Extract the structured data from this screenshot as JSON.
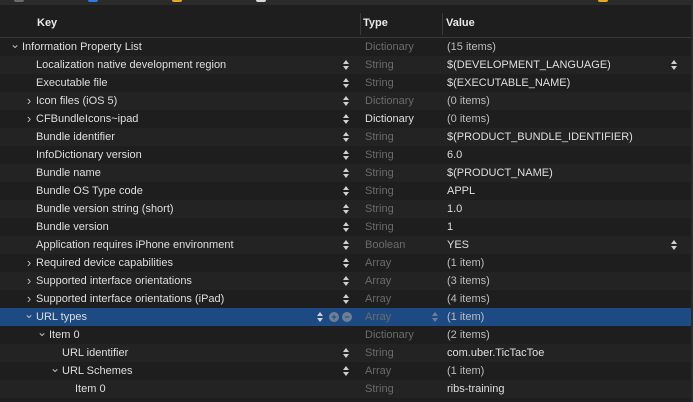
{
  "header": {
    "key": "Key",
    "type": "Type",
    "value": "Value"
  },
  "colors": {
    "selection": "#1d4a82",
    "background": "#1e1e1e",
    "dimText": "#6b6b6b"
  },
  "rows": [
    {
      "key": "Information Property List",
      "type": "Dictionary",
      "value": "(15 items)",
      "indent": 0,
      "disclosure": "expanded",
      "typeDim": true,
      "valueDim": true,
      "stepper": false,
      "valueStepper": false
    },
    {
      "key": "Localization native development region",
      "type": "String",
      "value": "$(DEVELOPMENT_LANGUAGE)",
      "indent": 1,
      "disclosure": "none",
      "typeDim": true,
      "valueDim": false,
      "stepper": true,
      "valueStepper": true
    },
    {
      "key": "Executable file",
      "type": "String",
      "value": "$(EXECUTABLE_NAME)",
      "indent": 1,
      "disclosure": "none",
      "typeDim": true,
      "valueDim": false,
      "stepper": true,
      "valueStepper": false
    },
    {
      "key": "Icon files (iOS 5)",
      "type": "Dictionary",
      "value": "(0 items)",
      "indent": 1,
      "disclosure": "collapsed",
      "typeDim": true,
      "valueDim": true,
      "stepper": true,
      "valueStepper": false
    },
    {
      "key": "CFBundleIcons~ipad",
      "type": "Dictionary",
      "value": "(0 items)",
      "indent": 1,
      "disclosure": "collapsed",
      "typeDim": false,
      "valueDim": true,
      "stepper": true,
      "valueStepper": false
    },
    {
      "key": "Bundle identifier",
      "type": "String",
      "value": "$(PRODUCT_BUNDLE_IDENTIFIER)",
      "indent": 1,
      "disclosure": "none",
      "typeDim": true,
      "valueDim": false,
      "stepper": true,
      "valueStepper": false
    },
    {
      "key": "InfoDictionary version",
      "type": "String",
      "value": "6.0",
      "indent": 1,
      "disclosure": "none",
      "typeDim": true,
      "valueDim": false,
      "stepper": true,
      "valueStepper": false
    },
    {
      "key": "Bundle name",
      "type": "String",
      "value": "$(PRODUCT_NAME)",
      "indent": 1,
      "disclosure": "none",
      "typeDim": true,
      "valueDim": false,
      "stepper": true,
      "valueStepper": false
    },
    {
      "key": "Bundle OS Type code",
      "type": "String",
      "value": "APPL",
      "indent": 1,
      "disclosure": "none",
      "typeDim": true,
      "valueDim": false,
      "stepper": true,
      "valueStepper": false
    },
    {
      "key": "Bundle version string (short)",
      "type": "String",
      "value": "1.0",
      "indent": 1,
      "disclosure": "none",
      "typeDim": true,
      "valueDim": false,
      "stepper": true,
      "valueStepper": false
    },
    {
      "key": "Bundle version",
      "type": "String",
      "value": "1",
      "indent": 1,
      "disclosure": "none",
      "typeDim": true,
      "valueDim": false,
      "stepper": true,
      "valueStepper": false
    },
    {
      "key": "Application requires iPhone environment",
      "type": "Boolean",
      "value": "YES",
      "indent": 1,
      "disclosure": "none",
      "typeDim": true,
      "valueDim": false,
      "stepper": true,
      "valueStepper": true
    },
    {
      "key": "Required device capabilities",
      "type": "Array",
      "value": "(1 item)",
      "indent": 1,
      "disclosure": "collapsed",
      "typeDim": true,
      "valueDim": true,
      "stepper": true,
      "valueStepper": false
    },
    {
      "key": "Supported interface orientations",
      "type": "Array",
      "value": "(3 items)",
      "indent": 1,
      "disclosure": "collapsed",
      "typeDim": true,
      "valueDim": true,
      "stepper": true,
      "valueStepper": false
    },
    {
      "key": "Supported interface orientations (iPad)",
      "type": "Array",
      "value": "(4 items)",
      "indent": 1,
      "disclosure": "collapsed",
      "typeDim": true,
      "valueDim": true,
      "stepper": true,
      "valueStepper": false
    },
    {
      "key": "URL types",
      "type": "Array",
      "value": "(1 item)",
      "indent": 1,
      "disclosure": "expanded",
      "typeDim": true,
      "valueDim": true,
      "stepper": true,
      "valueStepper": false,
      "selected": true
    },
    {
      "key": "Item 0",
      "type": "Dictionary",
      "value": "(2 items)",
      "indent": 2,
      "disclosure": "expanded",
      "typeDim": true,
      "valueDim": true,
      "stepper": false,
      "valueStepper": false
    },
    {
      "key": "URL identifier",
      "type": "String",
      "value": "com.uber.TicTacToe",
      "indent": 3,
      "disclosure": "none",
      "typeDim": true,
      "valueDim": false,
      "stepper": true,
      "valueStepper": false
    },
    {
      "key": "URL Schemes",
      "type": "Array",
      "value": "(1 item)",
      "indent": 3,
      "disclosure": "expanded",
      "typeDim": true,
      "valueDim": true,
      "stepper": true,
      "valueStepper": false
    },
    {
      "key": "Item 0",
      "type": "String",
      "value": "ribs-training",
      "indent": 4,
      "disclosure": "none",
      "typeDim": true,
      "valueDim": false,
      "stepper": false,
      "valueStepper": false
    }
  ]
}
